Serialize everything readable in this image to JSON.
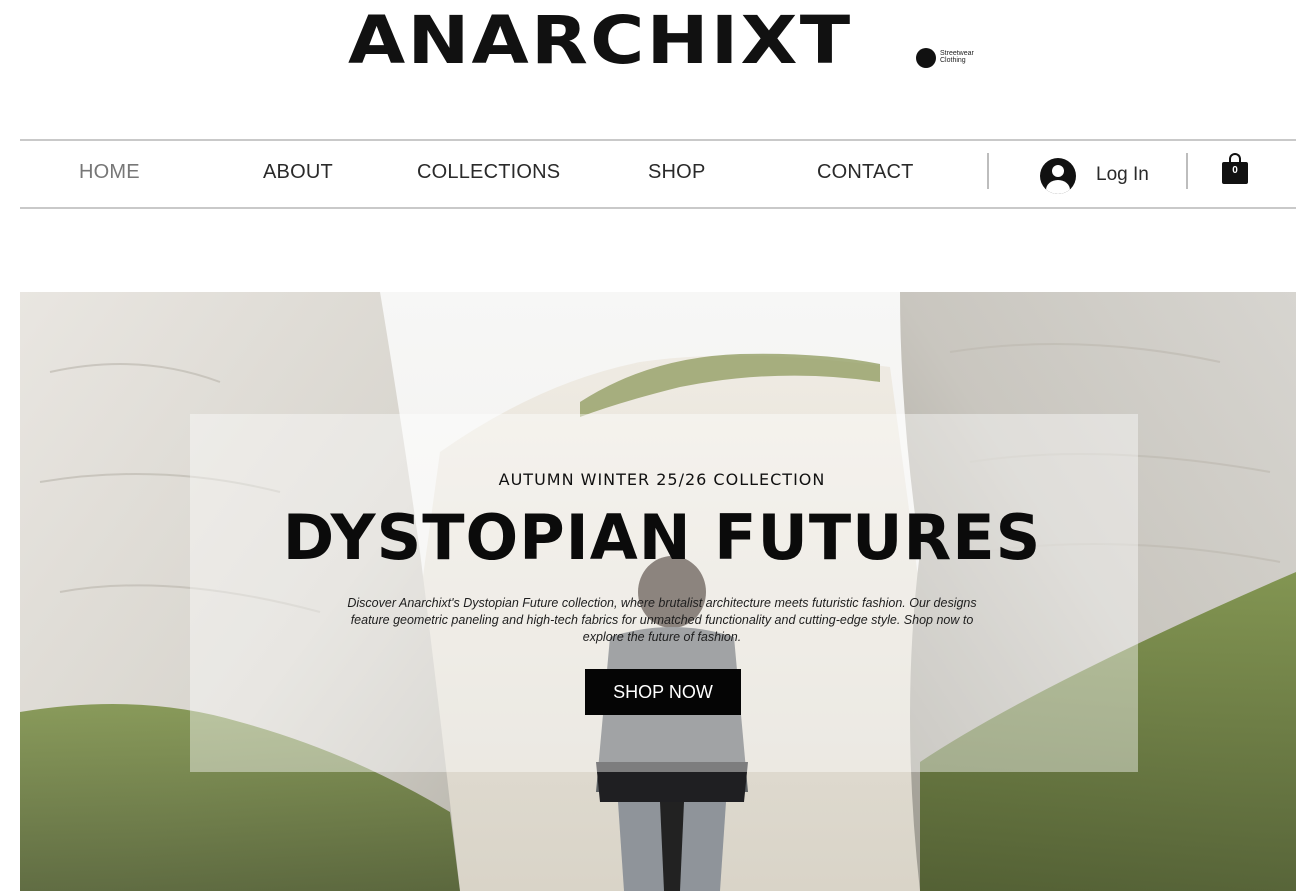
{
  "brand": {
    "name": "ANARCHIXT",
    "tagline": "Streetwear Clothing"
  },
  "nav": {
    "items": [
      {
        "label": "HOME",
        "active": true
      },
      {
        "label": "ABOUT",
        "active": false
      },
      {
        "label": "COLLECTIONS",
        "active": false
      },
      {
        "label": "SHOP",
        "active": false
      },
      {
        "label": "CONTACT",
        "active": false
      }
    ],
    "login_label": "Log In",
    "user_icon": "user-avatar-icon",
    "cart_icon": "shopping-bag-icon",
    "cart_count": "0"
  },
  "hero": {
    "eyebrow": "AUTUMN WINTER 25/26 COLLECTION",
    "title": "DYSTOPIAN FUTURES",
    "description": "Discover Anarchixt's Dystopian Future collection, where brutalist architecture meets futuristic fashion. Our designs feature geometric paneling and high-tech fabrics for unmatched functionality and cutting-edge style. Shop now to explore the future of fashion.",
    "cta_label": "SHOP NOW"
  },
  "colors": {
    "text": "#111111",
    "nav_active": "#777777",
    "button_bg": "#050505",
    "button_text": "#ffffff",
    "rule": "#c9c9c9"
  }
}
